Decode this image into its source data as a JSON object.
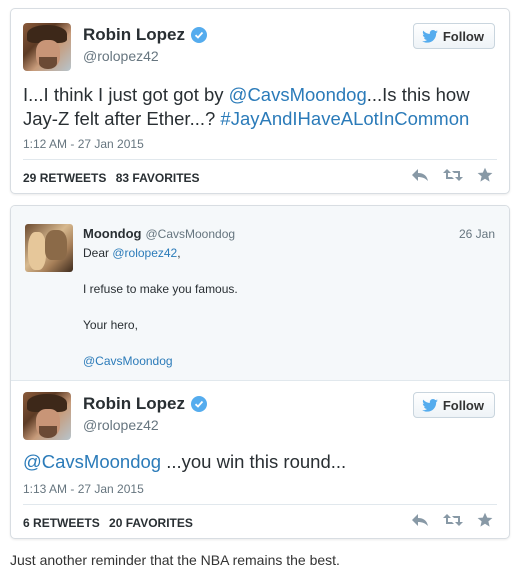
{
  "tweet1": {
    "name": "Robin Lopez",
    "handle": "@rolopez42",
    "follow_label": "Follow",
    "text_part1": "I...I think I just got got by ",
    "mention": "@CavsMoondog",
    "text_part2": "...Is this how Jay-Z felt after Ether...? ",
    "hashtag": "#JayAndIHaveALotInCommon",
    "timestamp": "1:12 AM - 27 Jan 2015",
    "retweets_count": "29",
    "retweets_label": "RETWEETS",
    "favorites_count": "83",
    "favorites_label": "FAVORITES"
  },
  "quoted": {
    "name": "Moondog",
    "handle": "@CavsMoondog",
    "date": "26 Jan",
    "line1_prefix": "Dear ",
    "line1_mention": "@rolopez42",
    "line1_suffix": ",",
    "line2": "I refuse to make you famous.",
    "line3": "Your hero,",
    "line4": "@CavsMoondog"
  },
  "tweet2": {
    "name": "Robin Lopez",
    "handle": "@rolopez42",
    "follow_label": "Follow",
    "mention": "@CavsMoondog",
    "text": " ...you win this round...",
    "timestamp": "1:13 AM - 27 Jan 2015",
    "retweets_count": "6",
    "retweets_label": "RETWEETS",
    "favorites_count": "20",
    "favorites_label": "FAVORITES"
  },
  "caption": "Just another reminder that the NBA remains the best.",
  "colors": {
    "link": "#2b7bb9",
    "verified": "#55acee",
    "twitter_bird": "#55acee",
    "muted": "#66757f"
  },
  "icons": [
    "verified-badge-icon",
    "twitter-bird-icon",
    "reply-icon",
    "retweet-icon",
    "favorite-star-icon"
  ]
}
